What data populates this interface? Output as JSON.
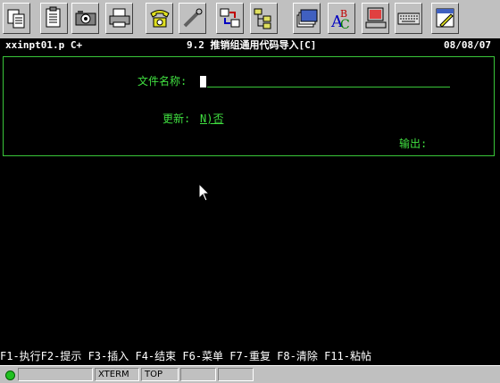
{
  "toolbar": {
    "buttons": [
      {
        "name": "cut-button",
        "icon": "cut-icon"
      },
      {
        "name": "copy-button",
        "icon": "copy-icon"
      },
      {
        "name": "camera-button",
        "icon": "camera-icon"
      },
      {
        "name": "print-button",
        "icon": "printer-icon"
      },
      {
        "name": "phone-button",
        "icon": "phone-icon"
      },
      {
        "name": "tool-button",
        "icon": "wrench-icon"
      },
      {
        "name": "transfer-button",
        "icon": "transfer-icon"
      },
      {
        "name": "tree-button",
        "icon": "tree-icon"
      },
      {
        "name": "files-button",
        "icon": "files-icon"
      },
      {
        "name": "spell-button",
        "icon": "spell-icon"
      },
      {
        "name": "computer-button",
        "icon": "computer-icon"
      },
      {
        "name": "keyboard-button",
        "icon": "keyboard-icon"
      },
      {
        "name": "edit-doc-button",
        "icon": "edit-doc-icon"
      }
    ]
  },
  "header": {
    "program": "xxinpt01.p C+",
    "title": "9.2 推销组通用代码导入[C]",
    "date": "08/08/07"
  },
  "form": {
    "file_label": "文件名称:",
    "file_value": "",
    "update_label": "更新:",
    "update_value": "N)否",
    "output_label": "输出:",
    "output_value": ""
  },
  "fkeys": "F1-执行F2-提示 F3-插入 F4-结束 F6-菜单 F7-重复 F8-清除 F11-粘帖",
  "statusbar": {
    "segments": [
      "",
      "XTERM",
      "TOP",
      "",
      ""
    ]
  },
  "colors": {
    "terminal_bg": "#000000",
    "terminal_fg": "#40e040",
    "header_fg": "#ffffff",
    "toolbar_bg": "#c0c0c0"
  }
}
